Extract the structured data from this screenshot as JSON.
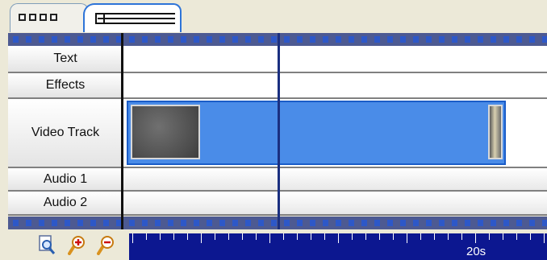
{
  "timeline": {
    "tracks": [
      {
        "label": "Text"
      },
      {
        "label": "Effects"
      },
      {
        "label": "Video Track"
      },
      {
        "label": "Audio 1"
      },
      {
        "label": "Audio 2"
      }
    ],
    "ruler": {
      "label": "20s"
    }
  },
  "icons": {
    "storyboard_tab": "storyboard-view-icon",
    "timeline_tab": "timeline-view-icon",
    "zoom_fit": "zoom-fit-icon",
    "zoom_in": "zoom-in-icon",
    "zoom_out": "zoom-out-icon"
  },
  "colors": {
    "clip": "#4a8ce8",
    "clip_border": "#1a5cc8",
    "playhead": "#1a2f80",
    "ruler": "#0c1790",
    "filmstrip": "#4d5a92",
    "filmstrip_hole": "#2d58c8",
    "tab_active_border": "#2e74d8"
  }
}
